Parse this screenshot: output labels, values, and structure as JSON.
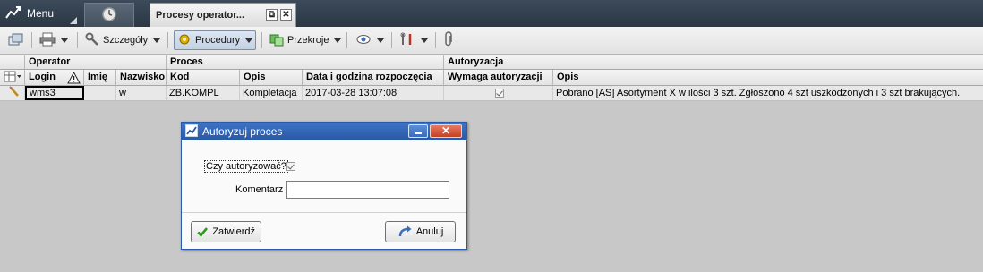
{
  "menu": {
    "label": "Menu"
  },
  "tabs": [
    {
      "label": "Procesy operator..."
    }
  ],
  "tab_buttons": {
    "restore": "⧉",
    "close": "✕"
  },
  "toolbar": {
    "details_label": "Szczegóły",
    "procedures_label": "Procedury",
    "sections_label": "Przekroje"
  },
  "grid": {
    "groups": [
      "Operator",
      "Proces",
      "Autoryzacja"
    ],
    "columns": [
      "Login",
      "Imię",
      "Nazwisko",
      "Kod",
      "Opis",
      "Data i godzina rozpoczęcia",
      "Wymaga autoryzacji",
      "Opis"
    ],
    "rows": [
      {
        "login": "wms3",
        "imie": "",
        "nazwisko": "w",
        "kod": "ZB.KOMPL",
        "opis": "Kompletacja",
        "data": "2017-03-28 13:07:08",
        "wymaga_autoryzacji": true,
        "opis_autoryzacji": "Pobrano [AS] Asortyment X w ilości 3 szt. Zgłoszono 4 szt uszkodzonych i 3 szt brakujących."
      }
    ]
  },
  "dialog": {
    "title": "Autoryzuj proces",
    "authorize_label": "Czy autoryzować?",
    "authorize_checked": true,
    "comment_label": "Komentarz",
    "comment_value": "",
    "confirm_label": "Zatwierdź",
    "cancel_label": "Anuluj"
  },
  "colors": {
    "title_bar": "#2a58a4",
    "close_button": "#c4411f",
    "top_bar": "#2b3744"
  }
}
